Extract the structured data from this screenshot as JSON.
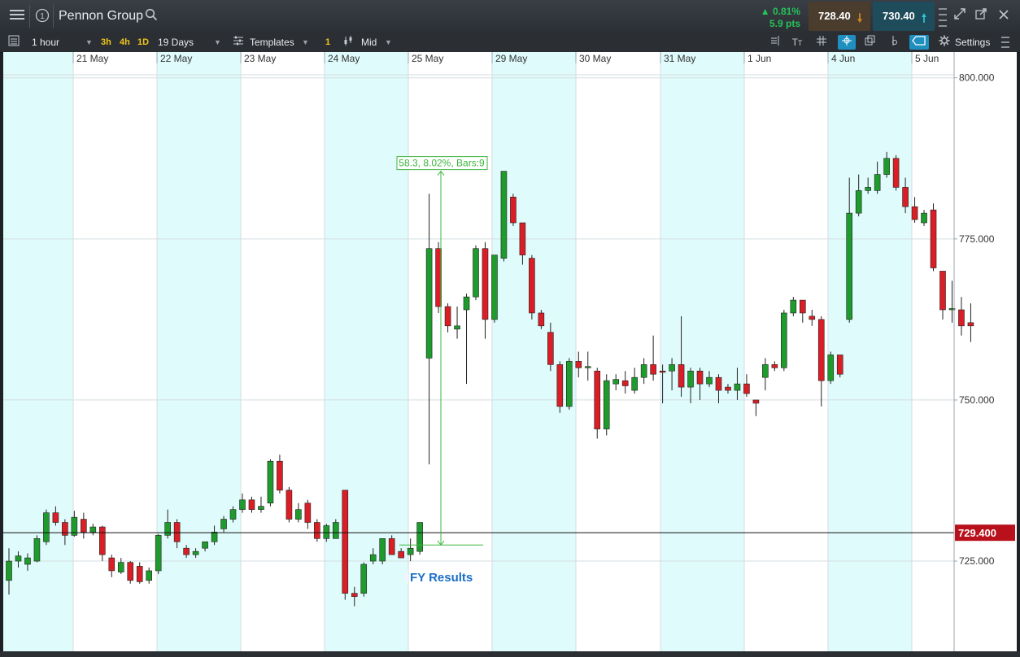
{
  "header": {
    "title": "Pennon Group",
    "change_pct": "0.81%",
    "change_pts": "5.9 pts",
    "sell_price": "728.40",
    "buy_price": "730.40",
    "icons": [
      "menu-icon",
      "info-icon",
      "search-icon",
      "expand-icon",
      "popout-icon",
      "close-icon"
    ]
  },
  "toolbar": {
    "interval": "1 hour",
    "quick_3h": "3h",
    "quick_4h": "4h",
    "quick_1d": "1D",
    "range": "19 Days",
    "templates": "Templates",
    "badge": "1",
    "price_type": "Mid",
    "settings": "Settings"
  },
  "colors": {
    "up": "#1e9b2c",
    "down": "#d91e26",
    "band": "#e0fbfb",
    "current_price_bg": "#b8111b",
    "measure": "#3cb53c",
    "annotation": "#1a6fc9"
  },
  "chart_data": {
    "type": "candlestick",
    "x": [
      "21 May",
      "22 May",
      "23 May",
      "24 May",
      "25 May",
      "29 May",
      "30 May",
      "31 May",
      "1 Jun",
      "4 Jun",
      "5 Jun"
    ],
    "ylim": [
      711,
      804
    ],
    "yticks": [
      "800.000",
      "775.000",
      "750.000",
      "725.000"
    ],
    "ytick_values": [
      800,
      775,
      750,
      725
    ],
    "current_price": 729.4,
    "current_price_label": "729.400",
    "measure": {
      "label": "58.3, 8.02%, Bars:9",
      "from": 727.5,
      "to": 785.5
    },
    "annotation": "FY Results",
    "grid": true,
    "candles": [
      [
        722,
        725,
        719.8,
        727
      ],
      [
        725,
        725.8,
        724,
        726.5
      ],
      [
        724.5,
        725.5,
        723.5,
        726.2
      ],
      [
        725,
        728.5,
        724.8,
        729
      ],
      [
        728,
        732.5,
        727.5,
        733
      ],
      [
        732.5,
        731,
        730.5,
        733.5
      ],
      [
        731,
        729,
        727.5,
        731.5
      ],
      [
        729,
        731.8,
        728.8,
        732.8
      ],
      [
        731.5,
        729.5,
        728.5,
        732.5
      ],
      [
        729.5,
        730.3,
        729,
        730.8
      ],
      [
        730.3,
        726,
        725,
        730.5
      ],
      [
        725.5,
        723.5,
        722.5,
        726
      ],
      [
        723.3,
        724.8,
        723,
        725.5
      ],
      [
        724.8,
        722,
        721.5,
        725
      ],
      [
        724.2,
        721.8,
        721.5,
        724.8
      ],
      [
        722,
        723.5,
        721.5,
        724
      ],
      [
        723.5,
        729,
        723,
        729.2
      ],
      [
        729,
        731,
        728.5,
        733
      ],
      [
        731,
        728,
        727,
        731.5
      ],
      [
        727,
        726,
        725.5,
        727.5
      ],
      [
        726,
        726.5,
        725.5,
        727
      ],
      [
        727,
        728,
        726.5,
        728
      ],
      [
        728,
        729.5,
        727.5,
        730.5
      ],
      [
        730,
        731.5,
        729.5,
        732
      ],
      [
        731.5,
        733,
        731,
        733.5
      ],
      [
        733,
        734.5,
        732.5,
        735.5
      ],
      [
        734.5,
        733,
        732.5,
        735
      ],
      [
        733,
        733.5,
        732.5,
        735
      ],
      [
        734,
        740.5,
        733.5,
        740.8
      ],
      [
        740.5,
        736,
        735.5,
        741.5
      ],
      [
        736,
        731.5,
        731,
        736.5
      ],
      [
        731.5,
        733,
        731,
        734
      ],
      [
        734,
        731,
        730,
        734.5
      ],
      [
        731,
        728.5,
        728,
        731.5
      ],
      [
        728.5,
        730.5,
        728,
        730.8
      ],
      [
        728.5,
        731,
        728.5,
        731.5
      ],
      [
        736,
        720,
        719,
        736
      ],
      [
        720,
        719.5,
        718,
        721
      ],
      [
        720,
        724.5,
        719.5,
        724.8
      ],
      [
        725,
        726,
        724.5,
        727
      ],
      [
        725,
        728.5,
        724.5,
        728.5
      ],
      [
        728.5,
        726,
        726,
        729
      ],
      [
        726.5,
        725.5,
        725.5,
        727
      ],
      [
        726,
        727,
        725,
        728.5
      ],
      [
        726.5,
        731,
        726,
        731
      ],
      [
        756.5,
        773.5,
        740,
        782
      ],
      [
        773.5,
        764.5,
        763.5,
        774.5
      ],
      [
        764.5,
        761.5,
        760.5,
        765
      ],
      [
        761,
        761.5,
        759.5,
        764.5
      ],
      [
        764,
        766,
        752.5,
        766.5
      ],
      [
        766,
        773.5,
        765.5,
        774
      ],
      [
        773.5,
        762.5,
        759.5,
        774.5
      ],
      [
        762.5,
        772.5,
        762,
        772.5
      ],
      [
        772,
        785.5,
        771.5,
        785.5
      ],
      [
        781.5,
        777.5,
        777,
        782
      ],
      [
        777.5,
        772.5,
        771,
        777.5
      ],
      [
        772,
        763.5,
        762.5,
        772.5
      ],
      [
        763.5,
        761.5,
        761,
        764
      ],
      [
        760.5,
        755.5,
        754.5,
        762
      ],
      [
        755.5,
        749,
        748,
        756
      ],
      [
        749,
        756,
        748.5,
        756.5
      ],
      [
        756,
        755,
        753.5,
        757.5
      ],
      [
        755,
        755.2,
        753,
        757.5
      ],
      [
        754.5,
        745.5,
        744,
        755
      ],
      [
        745.5,
        753,
        744.5,
        754
      ],
      [
        752.5,
        753.2,
        751.5,
        754
      ],
      [
        753,
        752.2,
        751,
        754.5
      ],
      [
        751.5,
        753.5,
        751,
        755
      ],
      [
        753.5,
        755.5,
        752.5,
        756.5
      ],
      [
        755.5,
        754,
        753,
        760
      ],
      [
        754.5,
        754.3,
        749.5,
        755.5
      ],
      [
        754.5,
        755.5,
        751.5,
        756.5
      ],
      [
        755.5,
        752,
        750.5,
        763
      ],
      [
        752,
        754.5,
        749.5,
        755
      ],
      [
        754.5,
        752.5,
        750,
        755
      ],
      [
        752.5,
        753.5,
        752,
        754.5
      ],
      [
        753.5,
        751.5,
        749.5,
        754
      ],
      [
        752,
        751.5,
        751,
        752.5
      ],
      [
        751.5,
        752.5,
        750,
        755
      ],
      [
        752.5,
        751,
        750.5,
        754
      ],
      [
        750,
        749.5,
        747.5,
        750
      ],
      [
        753.5,
        755.5,
        751.5,
        756.5
      ],
      [
        755.5,
        755,
        754.5,
        756
      ],
      [
        755,
        763.5,
        754.5,
        764
      ],
      [
        763.5,
        765.5,
        763,
        766
      ],
      [
        765.5,
        763.5,
        762,
        765.5
      ],
      [
        763,
        762.5,
        761.5,
        764
      ],
      [
        762.5,
        753,
        749,
        763
      ],
      [
        753,
        757,
        752.5,
        757.5
      ],
      [
        757,
        754,
        753.5,
        757
      ],
      [
        762.5,
        779,
        762,
        784.5
      ],
      [
        779,
        782.5,
        778.5,
        785
      ],
      [
        782.5,
        783,
        782,
        784.5
      ],
      [
        782.5,
        785,
        782,
        787
      ],
      [
        785,
        787.5,
        784.5,
        788.5
      ],
      [
        787.5,
        783,
        782.5,
        788
      ],
      [
        783,
        780,
        779,
        784.5
      ],
      [
        780,
        778,
        777.5,
        781.5
      ],
      [
        777.5,
        779,
        777,
        779.5
      ],
      [
        779.5,
        770.5,
        770,
        780.5
      ],
      [
        770,
        764,
        762.5,
        770
      ],
      [
        764,
        764.2,
        762,
        768.5
      ],
      [
        764,
        761.5,
        760,
        766
      ],
      [
        762,
        761.5,
        759,
        765
      ]
    ]
  }
}
